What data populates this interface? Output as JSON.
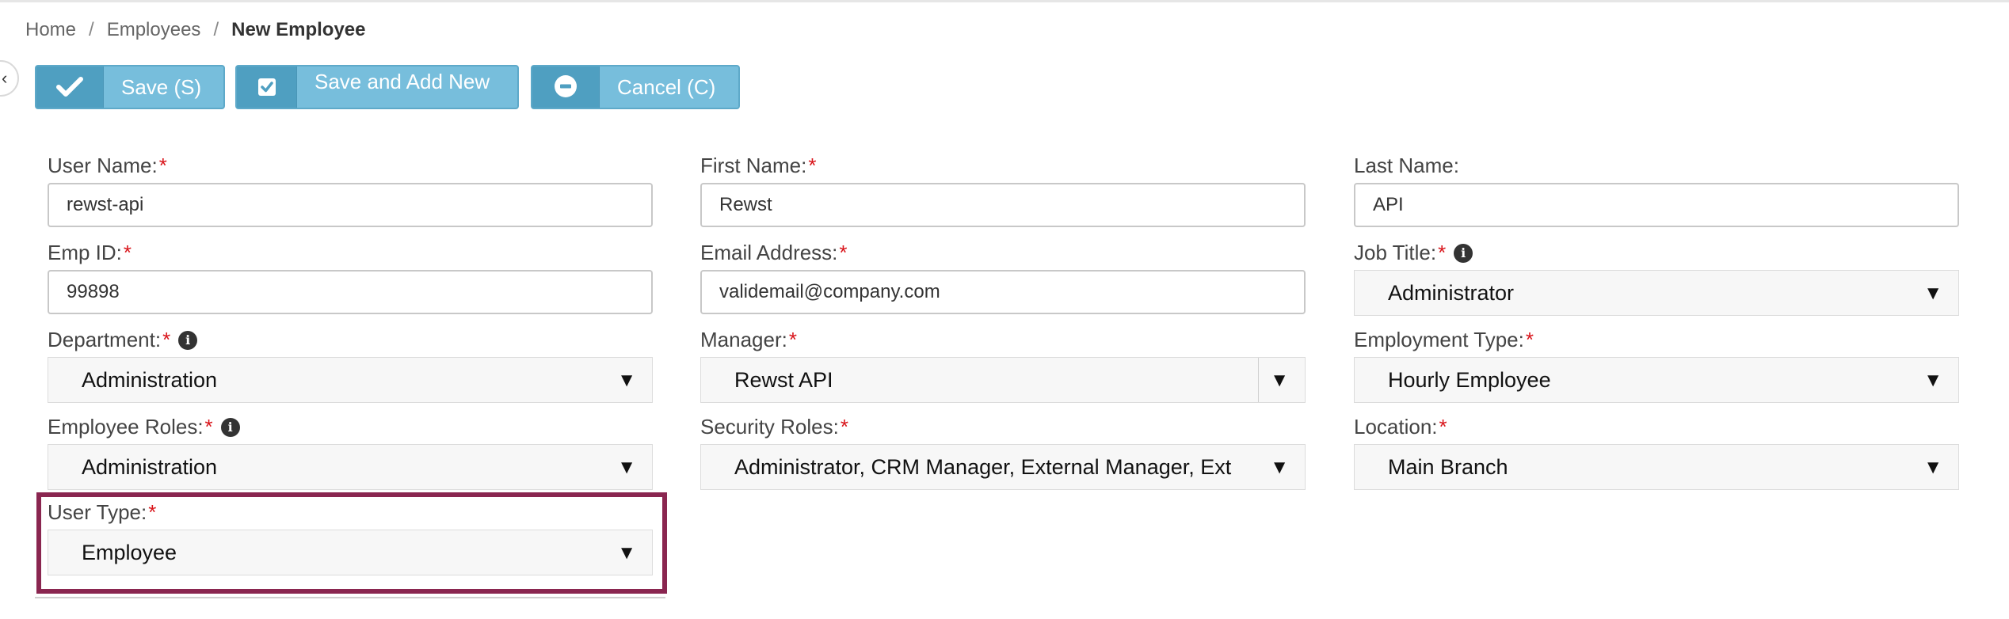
{
  "breadcrumb": {
    "home": "Home",
    "separator": "/",
    "employees": "Employees",
    "current": "New Employee"
  },
  "sidebar_toggle": "‹",
  "toolbar": {
    "save_label": "Save (S)",
    "save_add_label": "Save and Add New",
    "cancel_label": "Cancel (C)",
    "button_color": "#77bedc",
    "icon_bg_color": "#4f9fc1"
  },
  "form": {
    "required_mark": "*",
    "info_glyph": "i",
    "dropdown_glyph": "▼",
    "user_name": {
      "label": "User Name:",
      "value": "rewst-api"
    },
    "first_name": {
      "label": "First Name:",
      "value": "Rewst"
    },
    "last_name": {
      "label": "Last Name:",
      "value": "API"
    },
    "emp_id": {
      "label": "Emp ID:",
      "value": "99898"
    },
    "email": {
      "label": "Email Address:",
      "value": "validemail@company.com"
    },
    "job_title": {
      "label": "Job Title:",
      "value": "Administrator"
    },
    "department": {
      "label": "Department:",
      "value": "Administration"
    },
    "manager": {
      "label": "Manager:",
      "value": "Rewst API"
    },
    "employment_type": {
      "label": "Employment Type:",
      "value": "Hourly Employee"
    },
    "employee_roles": {
      "label": "Employee Roles:",
      "value": "Administration"
    },
    "security_roles": {
      "label": "Security Roles:",
      "value": "Administrator, CRM Manager, External Manager, Ext"
    },
    "location": {
      "label": "Location:",
      "value": "Main Branch"
    },
    "user_type": {
      "label": "User Type:",
      "value": "Employee"
    }
  },
  "colors": {
    "required": "#d9151b",
    "highlight_border": "#8a2650"
  }
}
